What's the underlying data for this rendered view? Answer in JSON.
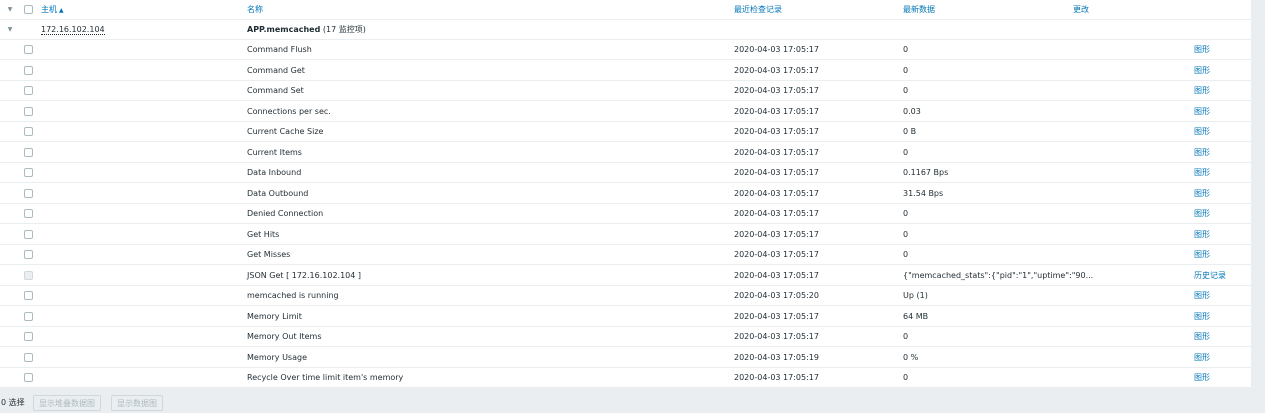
{
  "header": {
    "host_label": "主机",
    "sort_icon": "▲",
    "name_label": "名称",
    "last_check_label": "最近检查记录",
    "latest_data_label": "最新数据",
    "change_label": "更改"
  },
  "group": {
    "host": "172.16.102.104",
    "app_name": "APP.memcached",
    "app_count": "(17 监控项)"
  },
  "rows": [
    {
      "name": "Command Flush",
      "time": "2020-04-03 17:05:17",
      "value": "0",
      "action": "图形",
      "disabled": false
    },
    {
      "name": "Command Get",
      "time": "2020-04-03 17:05:17",
      "value": "0",
      "action": "图形",
      "disabled": false
    },
    {
      "name": "Command Set",
      "time": "2020-04-03 17:05:17",
      "value": "0",
      "action": "图形",
      "disabled": false
    },
    {
      "name": "Connections per sec.",
      "time": "2020-04-03 17:05:17",
      "value": "0.03",
      "action": "图形",
      "disabled": false
    },
    {
      "name": "Current Cache Size",
      "time": "2020-04-03 17:05:17",
      "value": "0 B",
      "action": "图形",
      "disabled": false
    },
    {
      "name": "Current Items",
      "time": "2020-04-03 17:05:17",
      "value": "0",
      "action": "图形",
      "disabled": false
    },
    {
      "name": "Data Inbound",
      "time": "2020-04-03 17:05:17",
      "value": "0.1167 Bps",
      "action": "图形",
      "disabled": false
    },
    {
      "name": "Data Outbound",
      "time": "2020-04-03 17:05:17",
      "value": "31.54 Bps",
      "action": "图形",
      "disabled": false
    },
    {
      "name": "Denied Connection",
      "time": "2020-04-03 17:05:17",
      "value": "0",
      "action": "图形",
      "disabled": false
    },
    {
      "name": "Get Hits",
      "time": "2020-04-03 17:05:17",
      "value": "0",
      "action": "图形",
      "disabled": false
    },
    {
      "name": "Get Misses",
      "time": "2020-04-03 17:05:17",
      "value": "0",
      "action": "图形",
      "disabled": false
    },
    {
      "name": "JSON Get [ 172.16.102.104 ]",
      "time": "2020-04-03 17:05:17",
      "value": "{\"memcached_stats\":{\"pid\":\"1\",\"uptime\":\"90...",
      "action": "历史记录",
      "disabled": true
    },
    {
      "name": "memcached is running",
      "time": "2020-04-03 17:05:20",
      "value": "Up (1)",
      "action": "图形",
      "disabled": false
    },
    {
      "name": "Memory Limit",
      "time": "2020-04-03 17:05:17",
      "value": "64 MB",
      "action": "图形",
      "disabled": false
    },
    {
      "name": "Memory Out Items",
      "time": "2020-04-03 17:05:17",
      "value": "0",
      "action": "图形",
      "disabled": false
    },
    {
      "name": "Memory Usage",
      "time": "2020-04-03 17:05:19",
      "value": "0 %",
      "action": "图形",
      "disabled": false
    },
    {
      "name": "Recycle Over time limit item's memory",
      "time": "2020-04-03 17:05:17",
      "value": "0",
      "action": "图形",
      "disabled": false
    }
  ],
  "footer": {
    "selected_count": "0 选择",
    "stacked_graph_button": "显示堆叠数据图",
    "graph_button": "显示数据图"
  },
  "colors": {
    "link": "#0275b8",
    "background": "#ebeef0",
    "table": "#ffffff"
  }
}
